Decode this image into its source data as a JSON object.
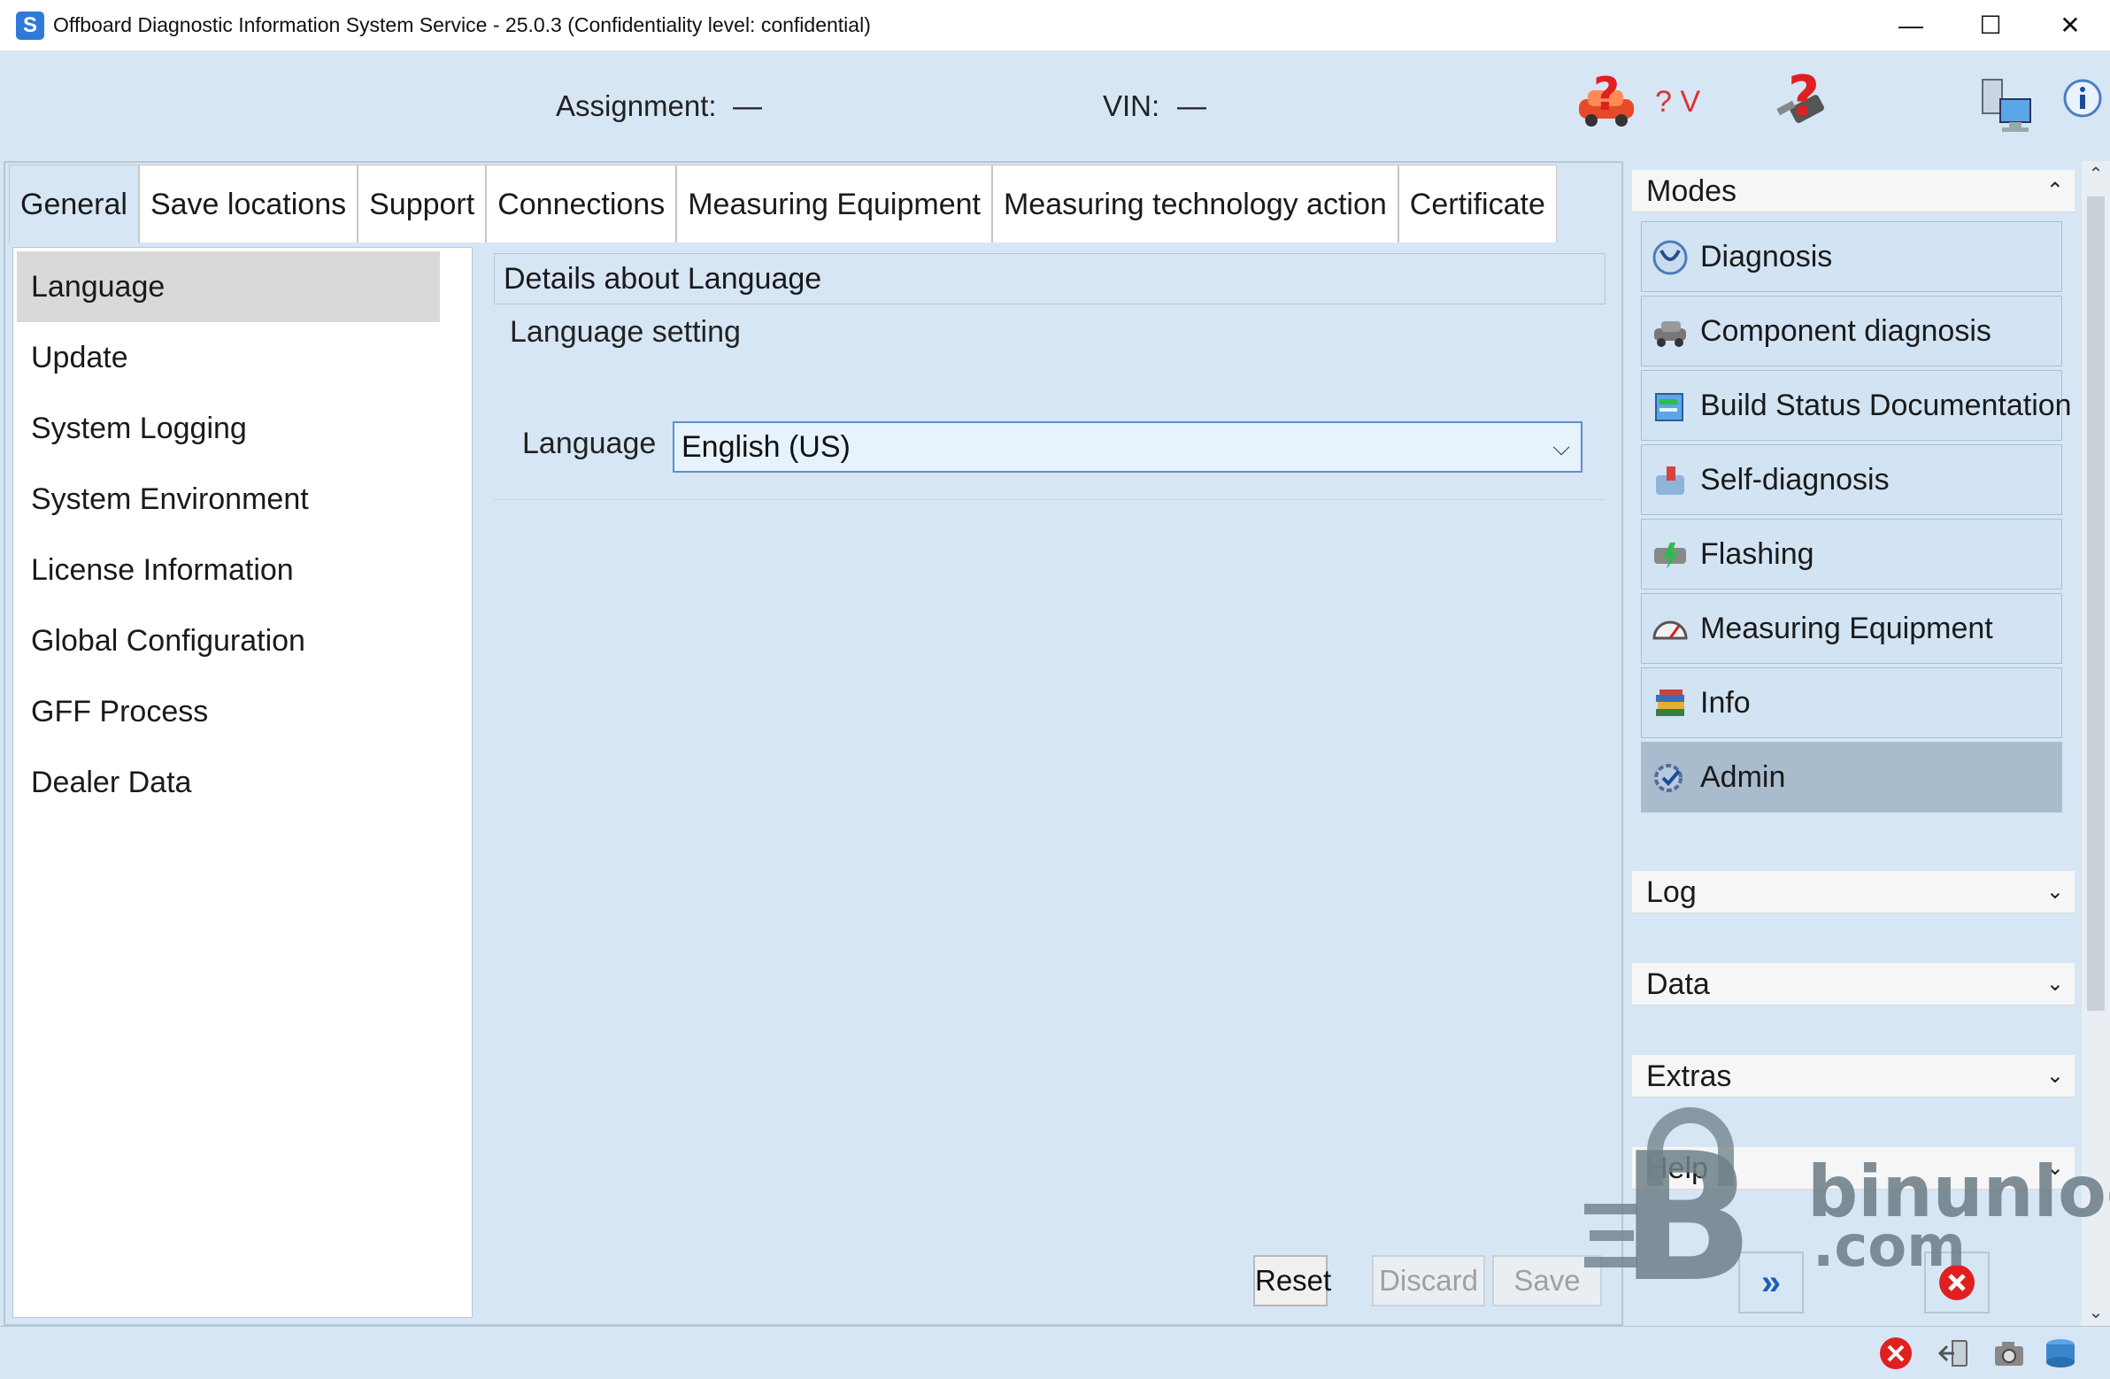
{
  "window": {
    "title": "Offboard Diagnostic Information System Service - 25.0.3 (Confidentiality level: confidential)",
    "icon_name": "odis-app-icon"
  },
  "header": {
    "assignment_label": "Assignment:",
    "assignment_value": "—",
    "vin_label": "VIN:",
    "vin_value": "—",
    "voltage_text": "? V"
  },
  "tabs": [
    {
      "label": "General",
      "active": true
    },
    {
      "label": "Save locations",
      "active": false
    },
    {
      "label": "Support",
      "active": false
    },
    {
      "label": "Connections",
      "active": false
    },
    {
      "label": "Measuring Equipment",
      "active": false
    },
    {
      "label": "Measuring technology action",
      "active": false
    },
    {
      "label": "Certificate",
      "active": false
    }
  ],
  "nav": [
    {
      "label": "Language",
      "active": true
    },
    {
      "label": "Update"
    },
    {
      "label": "System Logging"
    },
    {
      "label": "System Environment"
    },
    {
      "label": "License Information"
    },
    {
      "label": "Global Configuration"
    },
    {
      "label": "GFF Process"
    },
    {
      "label": "Dealer Data"
    }
  ],
  "details": {
    "title": "Details about Language",
    "section": "Language setting",
    "language_label": "Language",
    "language_value": "English (US)"
  },
  "buttons": {
    "reset": "Reset",
    "discard": "Discard",
    "save": "Save"
  },
  "modes": {
    "header": "Modes",
    "items": [
      {
        "label": "Diagnosis",
        "icon": "stethoscope-icon"
      },
      {
        "label": "Component diagnosis",
        "icon": "component-car-icon"
      },
      {
        "label": "Build Status Documentation",
        "icon": "documentation-icon"
      },
      {
        "label": "Self-diagnosis",
        "icon": "self-diagnosis-icon"
      },
      {
        "label": "Flashing",
        "icon": "flashing-icon"
      },
      {
        "label": "Measuring Equipment",
        "icon": "gauge-icon"
      },
      {
        "label": "Info",
        "icon": "books-icon"
      },
      {
        "label": "Admin",
        "icon": "admin-gear-icon",
        "active": true
      }
    ]
  },
  "sections": {
    "log": "Log",
    "data": "Data",
    "extras": "Extras",
    "help": "Help"
  },
  "watermark": {
    "brand": "binunlock",
    "domain": ".com"
  },
  "colors": {
    "panel_bg": "#d6e6f5",
    "active_mode": "#a9bccd",
    "select_border": "#5b8fd0",
    "error_red": "#e02020"
  }
}
